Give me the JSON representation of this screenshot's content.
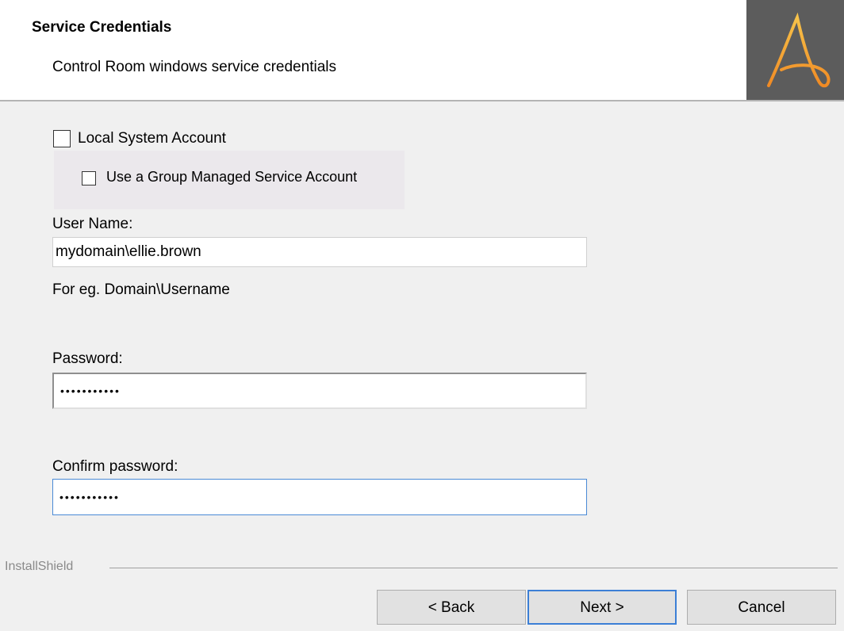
{
  "header": {
    "title": "Service Credentials",
    "subtitle": "Control Room windows service credentials",
    "logo_icon": "automation-anywhere-a-logo",
    "logo_background": "#5c5c5c",
    "logo_accent": "#f5a623"
  },
  "options": {
    "local_system_account": {
      "label": "Local System Account",
      "checked": false
    },
    "group_managed_service_account": {
      "label": "Use a Group Managed Service Account",
      "checked": false
    }
  },
  "form": {
    "username_label": "User Name:",
    "username_value": "mydomain\\ellie.brown",
    "username_hint": "For eg. Domain\\Username",
    "password_label": "Password:",
    "password_value": "•••••••••••",
    "confirm_label": "Confirm password:",
    "confirm_value": "•••••••••••"
  },
  "footer": {
    "brand": "InstallShield",
    "back_label": "< Back",
    "next_label": "Next >",
    "cancel_label": "Cancel"
  }
}
